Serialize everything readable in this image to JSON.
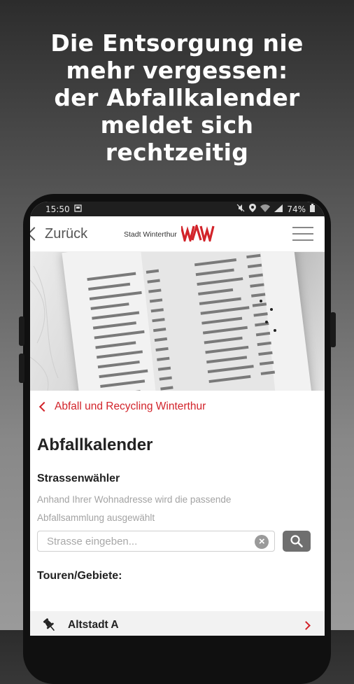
{
  "headline": {
    "lines": [
      "Die Entsorgung nie",
      "mehr vergessen:",
      "der Abfallkalender",
      "meldet sich",
      "rechtzeitig"
    ]
  },
  "statusbar": {
    "time": "15:50",
    "battery": "74%"
  },
  "navbar": {
    "back_label": "Zurück",
    "logo_text": "Stadt Winterthur"
  },
  "breadcrumb": {
    "label": "Abfall und Recycling Winterthur"
  },
  "page": {
    "title": "Abfallkalender",
    "street_selector": {
      "heading": "Strassenwähler",
      "description_line1": "Anhand Ihrer Wohnadresse wird die passende",
      "description_line2": "Abfallsammlung ausgewählt",
      "placeholder": "Strasse eingeben..."
    },
    "tours": {
      "heading": "Touren/Gebiete:",
      "items": [
        {
          "label": "Altstadt A"
        }
      ]
    }
  },
  "colors": {
    "accent": "#d2232a",
    "search_button": "#6f6f6f"
  }
}
